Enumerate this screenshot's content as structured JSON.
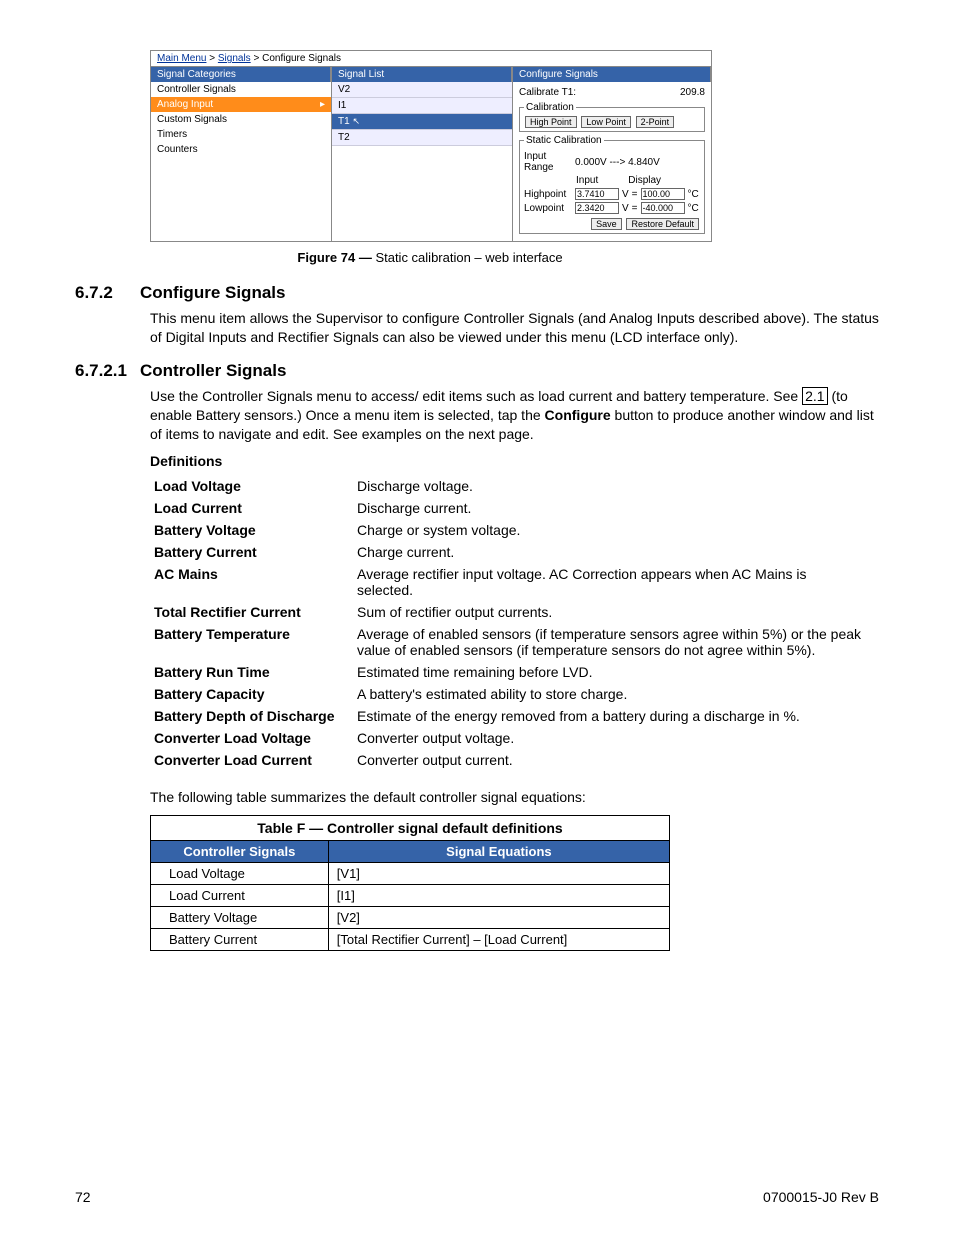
{
  "breadcrumb": {
    "a": "Main Menu",
    "b": "Signals",
    "c": "Configure Signals"
  },
  "panel": {
    "cat_head": "Signal Categories",
    "list_head": "Signal List",
    "cfg_head": "Configure Signals",
    "cats": {
      "c0": "Controller Signals",
      "c1": "Analog Input",
      "c2": "Custom Signals",
      "c3": "Timers",
      "c4": "Counters"
    },
    "sigs": {
      "s0": "V2",
      "s1": "I1",
      "s2": "T1",
      "s3": "T2"
    },
    "cfg": {
      "calib_lbl": "Calibrate T1:",
      "calib_val": "209.8",
      "calib_legend": "Calibration",
      "hp_btn": "High Point",
      "lp_btn": "Low Point",
      "tp_btn": "2-Point",
      "static_legend": "Static Calibration",
      "range_lbl": "Input Range",
      "range_val": "0.000V ---> 4.840V",
      "input_hdr": "Input",
      "display_hdr": "Display",
      "hp_lbl": "Highpoint",
      "hp_in": "3.7410",
      "hp_out": "100.00",
      "lp_lbl": "Lowpoint",
      "lp_in": "2.3420",
      "lp_out": "-40.000",
      "v": "V",
      "eq": "=",
      "degc": "°C",
      "save": "Save",
      "restore": "Restore Default"
    }
  },
  "fig": {
    "label": "Figure 74  — ",
    "text": "Static calibration – web interface"
  },
  "s672": {
    "num": "6.7.2",
    "title": "Configure Signals",
    "body": "This menu item allows the Supervisor to configure Controller Signals (and Analog Inputs described above). The status of Digital Inputs and Rectifier Signals can also be viewed under this menu (LCD interface only)."
  },
  "s6721": {
    "num": "6.7.2.1",
    "title": "Controller Signals",
    "b1": "Use the Controller Signals menu to access/ edit items such as load current and battery temperature. See ",
    "ref": "2.1",
    "b2": " (to enable Battery sensors.) Once a menu item is selected, tap the ",
    "cfg": "Configure",
    "b3": " button to produce another window and list of items to navigate and edit. See examples on the next page."
  },
  "def_title": "Definitions",
  "defs": {
    "t0": "Load Voltage",
    "d0": "Discharge voltage.",
    "t1": "Load Current",
    "d1": "Discharge current.",
    "t2": "Battery Voltage",
    "d2": "Charge or system voltage.",
    "t3": "Battery Current",
    "d3": "Charge current.",
    "t4": "AC Mains",
    "d4": "Average rectifier input voltage. AC Correction appears when AC Mains is selected.",
    "t5": "Total Rectifier Current",
    "d5": "Sum of rectifier output currents.",
    "t6": "Battery Temperature",
    "d6": "Average of enabled sensors (if temperature sensors agree within 5%) or the peak value of enabled sensors (if temperature sensors do not agree within 5%).",
    "t7": "Battery Run Time",
    "d7": "Estimated time remaining before LVD.",
    "t8": "Battery Capacity",
    "d8": "A battery's estimated ability to store charge.",
    "t9": "Battery Depth of Discharge",
    "d9": "Estimate of the energy removed from a battery during a discharge in %.",
    "t10": "Converter Load Voltage",
    "d10": "Converter output voltage.",
    "t11": "Converter Load Current",
    "d11": "Converter output current."
  },
  "para": "The following table summarizes the default controller signal equations:",
  "tableF": {
    "caption": "Table F  —  Controller signal default definitions",
    "h1": "Controller Signals",
    "h2": "Signal Equations",
    "r0a": "Load Voltage",
    "r0b": "[V1]",
    "r1a": "Load Current",
    "r1b": "[I1]",
    "r2a": "Battery Voltage",
    "r2b": "[V2]",
    "r3a": "Battery Current",
    "r3b": "[Total Rectifier Current] – [Load Current]"
  },
  "footer": {
    "page": "72",
    "doc": "0700015-J0    Rev B"
  }
}
